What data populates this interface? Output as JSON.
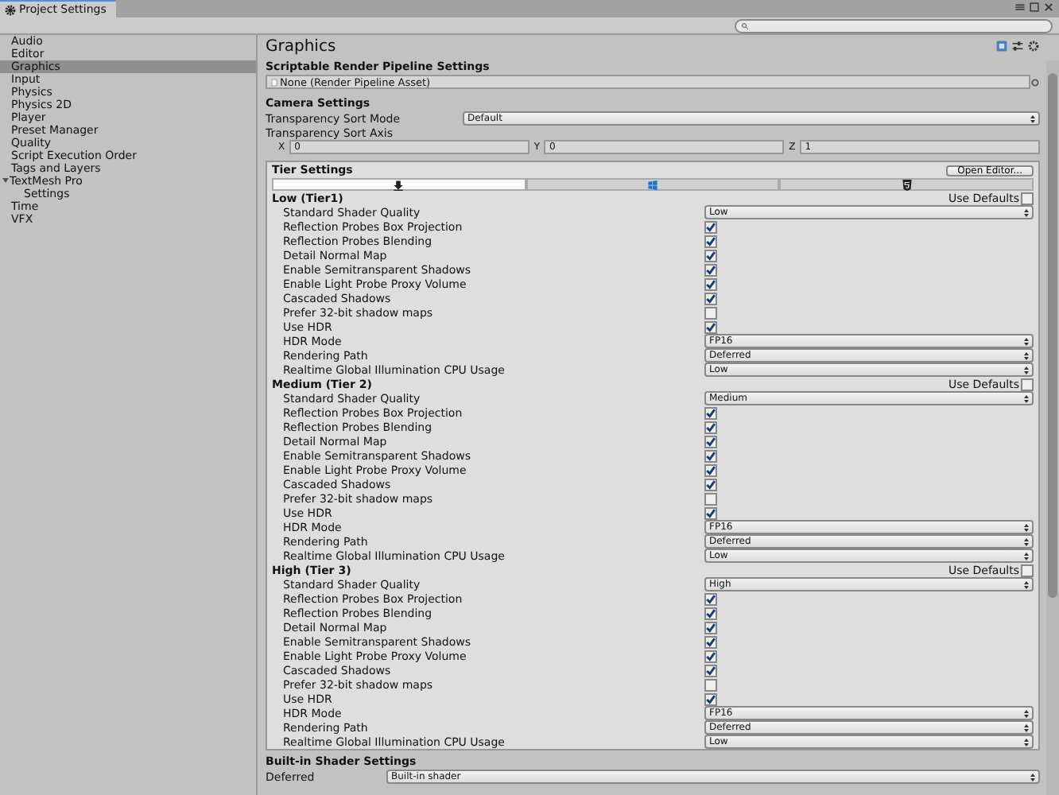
{
  "window": {
    "title": "Project Settings"
  },
  "sidebar": {
    "items": [
      {
        "label": "Audio",
        "selected": false
      },
      {
        "label": "Editor",
        "selected": false
      },
      {
        "label": "Graphics",
        "selected": true
      },
      {
        "label": "Input",
        "selected": false
      },
      {
        "label": "Physics",
        "selected": false
      },
      {
        "label": "Physics 2D",
        "selected": false
      },
      {
        "label": "Player",
        "selected": false
      },
      {
        "label": "Preset Manager",
        "selected": false
      },
      {
        "label": "Quality",
        "selected": false
      },
      {
        "label": "Script Execution Order",
        "selected": false
      },
      {
        "label": "Tags and Layers",
        "selected": false
      },
      {
        "label": "TextMesh Pro",
        "selected": false,
        "expanded": true,
        "children": [
          {
            "label": "Settings",
            "selected": false
          }
        ]
      },
      {
        "label": "Time",
        "selected": false
      },
      {
        "label": "VFX",
        "selected": false
      }
    ]
  },
  "page": {
    "title": "Graphics",
    "srp": {
      "heading": "Scriptable Render Pipeline Settings",
      "value": "None (Render Pipeline Asset)"
    },
    "camera": {
      "heading": "Camera Settings",
      "sort_mode_label": "Transparency Sort Mode",
      "sort_mode": "Default",
      "sort_axis_label": "Transparency Sort Axis",
      "axis": [
        {
          "label": "X",
          "value": "0"
        },
        {
          "label": "Y",
          "value": "0"
        },
        {
          "label": "Z",
          "value": "1"
        }
      ]
    },
    "tier_settings": {
      "heading": "Tier Settings",
      "button": "Open Editor...",
      "platforms": [
        {
          "kind": "standalone",
          "selected": true
        },
        {
          "kind": "windows",
          "selected": false
        },
        {
          "kind": "html5",
          "selected": false
        }
      ],
      "tiers": [
        {
          "name": "Low (Tier1)",
          "use_defaults_label": "Use Defaults",
          "use_defaults": false,
          "rows": [
            {
              "label": "Standard Shader Quality",
              "kind": "dropdown",
              "value": "Low"
            },
            {
              "label": "Reflection Probes Box Projection",
              "kind": "checkbox",
              "checked": true
            },
            {
              "label": "Reflection Probes Blending",
              "kind": "checkbox",
              "checked": true
            },
            {
              "label": "Detail Normal Map",
              "kind": "checkbox",
              "checked": true
            },
            {
              "label": "Enable Semitransparent Shadows",
              "kind": "checkbox",
              "checked": true
            },
            {
              "label": "Enable Light Probe Proxy Volume",
              "kind": "checkbox",
              "checked": true
            },
            {
              "label": "Cascaded Shadows",
              "kind": "checkbox",
              "checked": true
            },
            {
              "label": "Prefer 32-bit shadow maps",
              "kind": "checkbox",
              "checked": false
            },
            {
              "label": "Use HDR",
              "kind": "checkbox",
              "checked": true
            },
            {
              "label": "HDR Mode",
              "kind": "dropdown",
              "value": "FP16"
            },
            {
              "label": "Rendering Path",
              "kind": "dropdown",
              "value": "Deferred"
            },
            {
              "label": "Realtime Global Illumination CPU Usage",
              "kind": "dropdown",
              "value": "Low"
            }
          ]
        },
        {
          "name": "Medium (Tier 2)",
          "use_defaults_label": "Use Defaults",
          "use_defaults": false,
          "rows": [
            {
              "label": "Standard Shader Quality",
              "kind": "dropdown",
              "value": "Medium"
            },
            {
              "label": "Reflection Probes Box Projection",
              "kind": "checkbox",
              "checked": true
            },
            {
              "label": "Reflection Probes Blending",
              "kind": "checkbox",
              "checked": true
            },
            {
              "label": "Detail Normal Map",
              "kind": "checkbox",
              "checked": true
            },
            {
              "label": "Enable Semitransparent Shadows",
              "kind": "checkbox",
              "checked": true
            },
            {
              "label": "Enable Light Probe Proxy Volume",
              "kind": "checkbox",
              "checked": true
            },
            {
              "label": "Cascaded Shadows",
              "kind": "checkbox",
              "checked": true
            },
            {
              "label": "Prefer 32-bit shadow maps",
              "kind": "checkbox",
              "checked": false
            },
            {
              "label": "Use HDR",
              "kind": "checkbox",
              "checked": true
            },
            {
              "label": "HDR Mode",
              "kind": "dropdown",
              "value": "FP16"
            },
            {
              "label": "Rendering Path",
              "kind": "dropdown",
              "value": "Deferred"
            },
            {
              "label": "Realtime Global Illumination CPU Usage",
              "kind": "dropdown",
              "value": "Low"
            }
          ]
        },
        {
          "name": "High (Tier 3)",
          "use_defaults_label": "Use Defaults",
          "use_defaults": false,
          "rows": [
            {
              "label": "Standard Shader Quality",
              "kind": "dropdown",
              "value": "High"
            },
            {
              "label": "Reflection Probes Box Projection",
              "kind": "checkbox",
              "checked": true
            },
            {
              "label": "Reflection Probes Blending",
              "kind": "checkbox",
              "checked": true
            },
            {
              "label": "Detail Normal Map",
              "kind": "checkbox",
              "checked": true
            },
            {
              "label": "Enable Semitransparent Shadows",
              "kind": "checkbox",
              "checked": true
            },
            {
              "label": "Enable Light Probe Proxy Volume",
              "kind": "checkbox",
              "checked": true
            },
            {
              "label": "Cascaded Shadows",
              "kind": "checkbox",
              "checked": true
            },
            {
              "label": "Prefer 32-bit shadow maps",
              "kind": "checkbox",
              "checked": false
            },
            {
              "label": "Use HDR",
              "kind": "checkbox",
              "checked": true
            },
            {
              "label": "HDR Mode",
              "kind": "dropdown",
              "value": "FP16"
            },
            {
              "label": "Rendering Path",
              "kind": "dropdown",
              "value": "Deferred"
            },
            {
              "label": "Realtime Global Illumination CPU Usage",
              "kind": "dropdown",
              "value": "Low"
            }
          ]
        }
      ]
    },
    "builtin": {
      "heading": "Built-in Shader Settings",
      "rows": [
        {
          "label": "Deferred",
          "value": "Built-in shader"
        }
      ]
    }
  }
}
